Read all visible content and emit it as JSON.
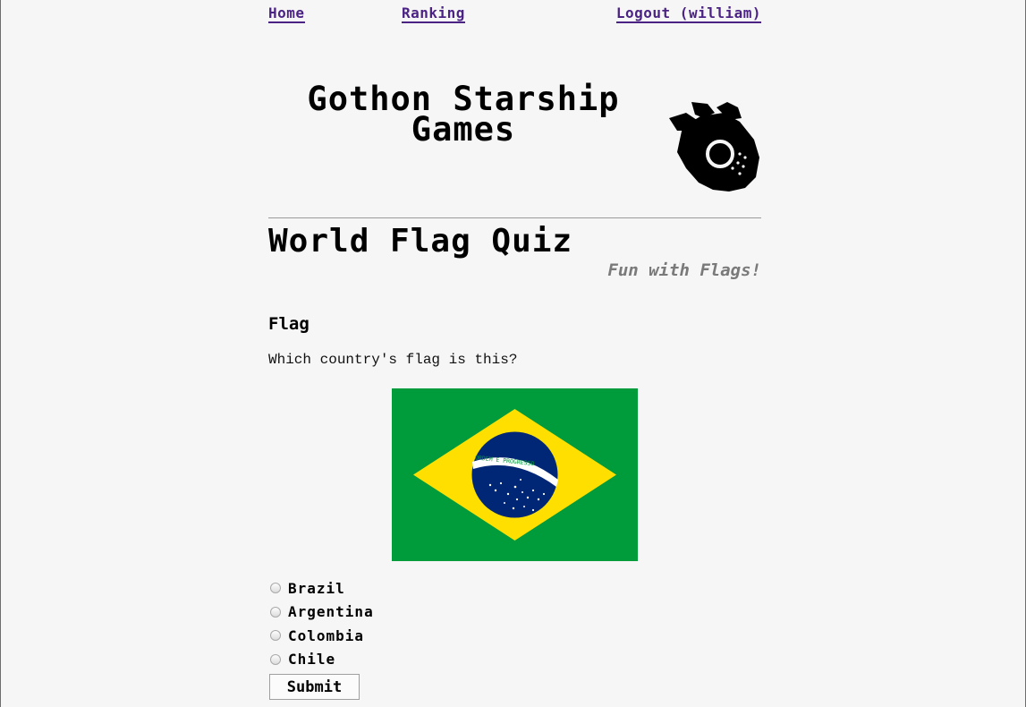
{
  "nav": {
    "home": "Home",
    "ranking": "Ranking",
    "logout": "Logout (william)"
  },
  "header": {
    "title_line1": "Gothon Starship",
    "title_line2": "Games",
    "logo_icon": "spaceship-icon"
  },
  "quiz": {
    "title": "World Flag Quiz",
    "subtitle": "Fun with Flags!",
    "section": "Flag",
    "question": "Which country's flag is this?",
    "flag_image": "brazil-flag",
    "flag_motto": "ORDEM E PROGRESSO",
    "options": [
      {
        "label": "Brazil",
        "selected": false
      },
      {
        "label": "Argentina",
        "selected": false
      },
      {
        "label": "Colombia",
        "selected": false
      },
      {
        "label": "Chile",
        "selected": false
      }
    ],
    "submit_label": "Submit"
  },
  "colors": {
    "background": "#f6f6f6",
    "link": "#4b2385",
    "subtitle": "#7a7a7a",
    "flag_green": "#009b3a",
    "flag_yellow": "#fedf00",
    "flag_blue": "#002776"
  }
}
